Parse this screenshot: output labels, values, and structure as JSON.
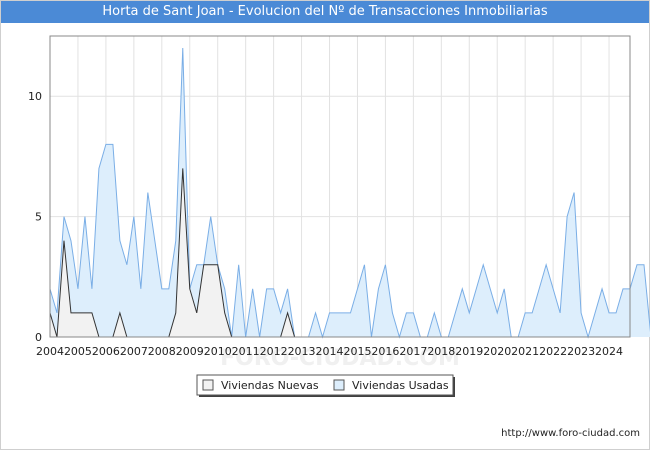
{
  "title": "Horta de Sant Joan - Evolucion del Nº de Transacciones Inmobiliarias",
  "source": "http://www.foro-ciudad.com",
  "watermark": "FORO-CIUDAD.COM",
  "colors": {
    "title_bg": "#4b8ad6",
    "nuevas_fill": "#f2f2f2",
    "nuevas_line": "#333333",
    "usadas_fill": "#ddeefc",
    "usadas_line": "#7aaee6"
  },
  "chart_data": {
    "type": "area",
    "title": "Horta de Sant Joan - Evolucion del Nº de Transacciones Inmobiliarias",
    "x_start_year": 2004,
    "points_per_year": 4,
    "xlim": [
      2004,
      2024.75
    ],
    "ylim": [
      0,
      12.5
    ],
    "yticks": [
      0,
      5,
      10
    ],
    "xticks": [
      "2004",
      "2005",
      "2006",
      "2007",
      "2008",
      "2009",
      "2010",
      "2011",
      "2012",
      "2013",
      "2014",
      "2015",
      "2016",
      "2017",
      "2018",
      "2019",
      "2020",
      "2021",
      "2022",
      "2023",
      "2024"
    ],
    "grid": true,
    "legend_position": "bottom",
    "series": [
      {
        "name": "Viviendas Nuevas",
        "values": [
          1,
          0,
          4,
          1,
          1,
          1,
          1,
          0,
          0,
          0,
          1,
          0,
          0,
          0,
          0,
          0,
          0,
          0,
          1,
          7,
          2,
          1,
          3,
          3,
          3,
          1,
          0,
          0,
          0,
          0,
          0,
          0,
          0,
          0,
          1,
          0,
          0,
          0,
          0,
          0,
          0,
          0,
          0,
          0,
          0,
          0,
          0,
          0,
          0,
          0,
          0,
          0,
          0,
          0,
          0,
          0,
          0,
          0,
          0,
          0,
          0,
          0,
          0,
          0,
          0,
          0,
          0,
          0,
          0,
          0,
          0,
          0,
          0,
          0,
          0,
          0,
          0,
          0,
          0,
          0,
          0,
          0,
          0,
          0
        ]
      },
      {
        "name": "Viviendas Usadas",
        "values": [
          2,
          1,
          5,
          4,
          2,
          5,
          2,
          7,
          8,
          8,
          4,
          3,
          5,
          2,
          6,
          4,
          2,
          2,
          4,
          12,
          2,
          3,
          3,
          5,
          3,
          2,
          0,
          3,
          0,
          2,
          0,
          2,
          2,
          1,
          2,
          0,
          0,
          0,
          1,
          0,
          1,
          1,
          1,
          1,
          2,
          3,
          0,
          2,
          3,
          1,
          0,
          1,
          1,
          0,
          0,
          1,
          0,
          0,
          1,
          2,
          1,
          2,
          3,
          2,
          1,
          2,
          0,
          0,
          1,
          1,
          2,
          3,
          2,
          1,
          5,
          6,
          1,
          0,
          1,
          2,
          1,
          1,
          2,
          2,
          3,
          3,
          0
        ]
      }
    ]
  }
}
